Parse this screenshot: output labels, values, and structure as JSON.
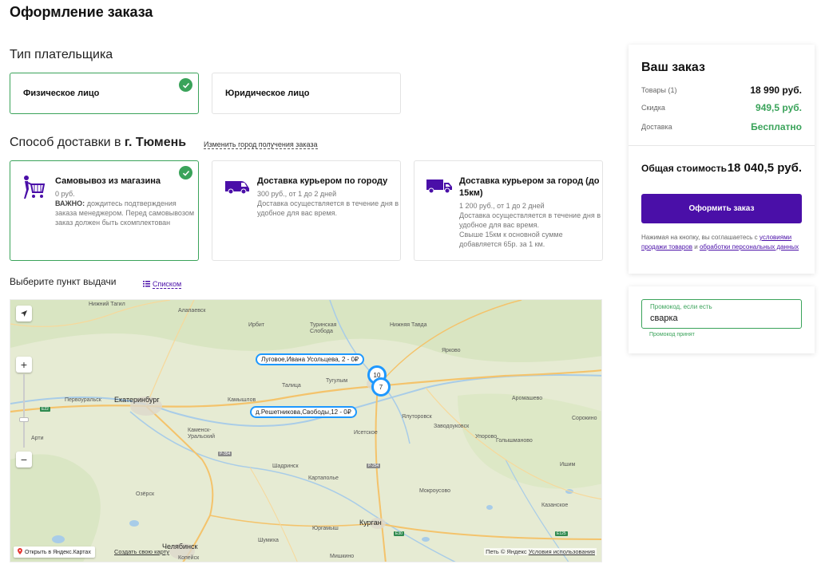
{
  "page": {
    "title": "Оформление заказа"
  },
  "payer": {
    "title": "Тип плательщика",
    "options": [
      {
        "label": "Физическое лицо",
        "selected": true
      },
      {
        "label": "Юридическое лицо",
        "selected": false
      }
    ]
  },
  "delivery": {
    "title_prefix": "Способ доставки в",
    "city": "г. Тюмень",
    "change_city_link": "Изменить город получения заказа",
    "options": [
      {
        "icon": "shopping-cart-person-icon",
        "title": "Самовывоз из магазина",
        "price": "0 руб.",
        "note_bold": "ВАЖНО:",
        "note": "дождитесь подтверждения заказа менеджером. Перед самовывозом заказ должен быть скомплектован",
        "selected": true
      },
      {
        "icon": "van-icon",
        "title": "Доставка курьером по городу",
        "price": "300 руб., от 1 до 2 дней",
        "note": "Доставка осуществляется в течение дня в удобное для вас время.",
        "selected": false
      },
      {
        "icon": "truck-icon",
        "title": "Доставка курьером за город (до 15км)",
        "price": "1 200 руб., от 1 до 2 дней",
        "note": "Доставка осуществляется в течение дня в удобное для вас время.",
        "note2": "Свыше 15км к основной сумме добавляется 65р. за 1 км.",
        "selected": false
      }
    ]
  },
  "pickup": {
    "title": "Выберите пункт выдачи",
    "list_link": "Списком"
  },
  "map": {
    "cities": [
      {
        "name": "Нижний Тагил",
        "big": false
      },
      {
        "name": "Алапаевск",
        "big": false
      },
      {
        "name": "Ирбит",
        "big": false
      },
      {
        "name": "Туринская Слобода",
        "big": false
      },
      {
        "name": "Нижняя Тавда",
        "big": false
      },
      {
        "name": "Ярково",
        "big": false
      },
      {
        "name": "Первоуральск",
        "big": false
      },
      {
        "name": "Екатеринбург",
        "big": true
      },
      {
        "name": "Камышлов",
        "big": false
      },
      {
        "name": "Талица",
        "big": false
      },
      {
        "name": "Тугулым",
        "big": false
      },
      {
        "name": "Ялуторовск",
        "big": false
      },
      {
        "name": "Заводоуковск",
        "big": false
      },
      {
        "name": "Аромашево",
        "big": false
      },
      {
        "name": "Каменск-Уральский",
        "big": false
      },
      {
        "name": "Исетское",
        "big": false
      },
      {
        "name": "Упорово",
        "big": false
      },
      {
        "name": "Голышманово",
        "big": false
      },
      {
        "name": "Арти",
        "big": false
      },
      {
        "name": "Шадринск",
        "big": false
      },
      {
        "name": "Картаполье",
        "big": false
      },
      {
        "name": "Ишим",
        "big": false
      },
      {
        "name": "Мокроусово",
        "big": false
      },
      {
        "name": "Казанское",
        "big": false
      },
      {
        "name": "Курган",
        "big": true
      },
      {
        "name": "Юргамыш",
        "big": false
      },
      {
        "name": "Шумиха",
        "big": false
      },
      {
        "name": "Челябинск",
        "big": true
      },
      {
        "name": "Озёрск",
        "big": false
      },
      {
        "name": "Копейск",
        "big": false
      },
      {
        "name": "Мишкино",
        "big": false
      },
      {
        "name": "Сорокино",
        "big": false
      }
    ],
    "markers": [
      {
        "label": "Луговое,Ивана Усольцева, 2 - 0₽"
      },
      {
        "label": "д.Решетникова,Свободы,12 - 0₽"
      }
    ],
    "clusters": [
      "10",
      "7"
    ],
    "roads": [
      "E22",
      "P-354",
      "P-254",
      "E30",
      "E125"
    ],
    "open_in_maps": "Открыть в Яндекс.Картах",
    "create_map": "Создать свою карту",
    "copyright": "Петь © Яндекс",
    "terms": "Условия использования",
    "zoom_in": "+",
    "zoom_out": "−"
  },
  "summary": {
    "title": "Ваш заказ",
    "goods_label": "Товары (1)",
    "goods_value": "18 990 руб.",
    "discount_label": "Скидка",
    "discount_value": "949,5 руб.",
    "delivery_label": "Доставка",
    "delivery_value": "Бесплатно",
    "total_label": "Общая стоимость",
    "total_value": "18 040,5 руб.",
    "order_button": "Оформить заказ",
    "agree_text": "Нажимая на кнопку, вы соглашаетесь с",
    "agree_link1": "условиями продажи товаров",
    "agree_and": "и",
    "agree_link2": "обработки персональных данных"
  },
  "promo": {
    "label": "Промокод, если есть",
    "value": "сварка",
    "status": "Промокод принят"
  },
  "colors": {
    "accent": "#4a0fa8",
    "success": "#3aa35a",
    "map_pin": "#1e98ff"
  }
}
